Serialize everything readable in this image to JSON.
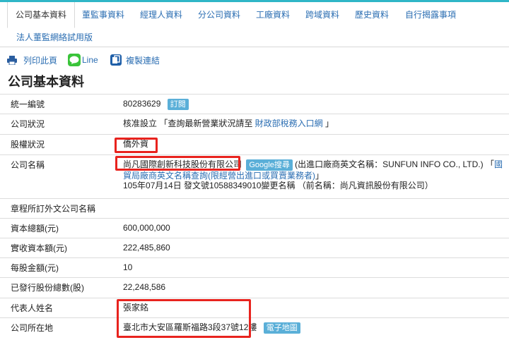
{
  "tabs": [
    "公司基本資料",
    "董監事資料",
    "經理人資料",
    "分公司資料",
    "工廠資料",
    "跨域資料",
    "歷史資料",
    "自行揭露事項",
    "法人董監網絡試用版"
  ],
  "tools": {
    "print": "列印此頁",
    "line": "Line",
    "copy": "複製連結"
  },
  "page_title": "公司基本資料",
  "rows": {
    "unified_no": {
      "label": "統一編號",
      "value": "80283629",
      "badge": "訂閱"
    },
    "status": {
      "label": "公司狀況",
      "value_pre": "核准設立 「查詢最新營業狀況請至 ",
      "link": "財政部稅務入口網",
      "value_post": " 」"
    },
    "equity": {
      "label": "股權狀況",
      "value": "僑外資"
    },
    "name": {
      "label": "公司名稱",
      "value": "尚凡國際創新科技股份有限公司",
      "badge": "Google搜尋",
      "english_note": " (出進口廠商英文名稱：SUNFUN INFO CO., LTD.) 「",
      "link": "國貿局廠商英文名稱查詢(限經營出進口或買賣業務者)",
      "link_end": "」",
      "change_note": "105年07月14日 發文號10588349010變更名稱 （前名稱：尚凡資訊股份有限公司）"
    },
    "foreign_name": {
      "label": "章程所訂外文公司名稱",
      "value": ""
    },
    "capital": {
      "label": "資本總額(元)",
      "value": "600,000,000"
    },
    "paid_capital": {
      "label": "實收資本額(元)",
      "value": "222,485,860"
    },
    "par_value": {
      "label": "每股金額(元)",
      "value": "10"
    },
    "shares": {
      "label": "已發行股份總數(股)",
      "value": "22,248,586"
    },
    "representative": {
      "label": "代表人姓名",
      "value": "張家銘"
    },
    "address": {
      "label": "公司所在地",
      "value": "臺北市大安區羅斯福路3段37號12樓",
      "badge": "電子地圖"
    }
  },
  "colors": {
    "accent": "#2fb6c7",
    "link": "#2a6db2",
    "highlight": "#e8231e",
    "badge": "#5aafd8"
  }
}
